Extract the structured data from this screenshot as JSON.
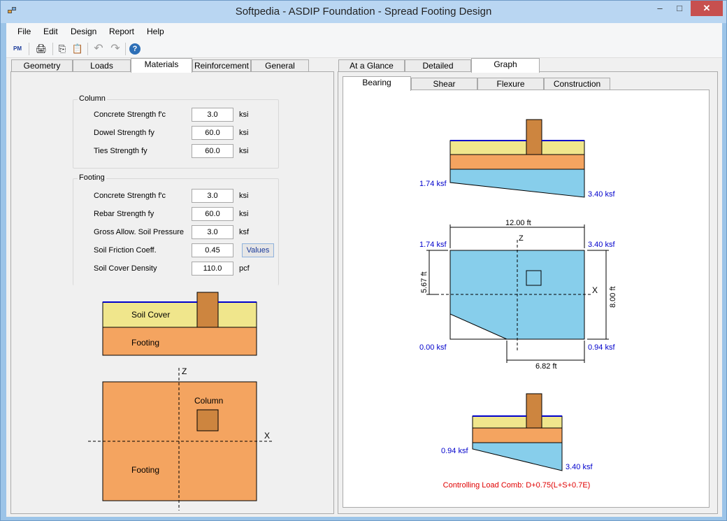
{
  "window": {
    "title": "Softpedia - ASDIP Foundation - Spread Footing Design"
  },
  "menu": [
    "File",
    "Edit",
    "Design",
    "Report",
    "Help"
  ],
  "toolbar": {
    "items": [
      {
        "name": "back-pm-icon",
        "glyph": "PM"
      },
      {
        "name": "print-icon",
        "glyph": "🖨"
      },
      {
        "name": "copy-icon",
        "glyph": "⎘"
      },
      {
        "name": "paste-icon",
        "glyph": "📋"
      },
      {
        "name": "undo-icon",
        "glyph": "↶"
      },
      {
        "name": "redo-icon",
        "glyph": "↷"
      },
      {
        "name": "help-icon",
        "glyph": "?"
      }
    ]
  },
  "left_tabs": [
    {
      "label": "Geometry"
    },
    {
      "label": "Loads"
    },
    {
      "label": "Materials",
      "active": true
    },
    {
      "label": "Reinforcement"
    },
    {
      "label": "General"
    }
  ],
  "right_tabs": [
    {
      "label": "At a Glance"
    },
    {
      "label": "Detailed"
    },
    {
      "label": "Graph",
      "active": true
    }
  ],
  "graph_tabs": [
    {
      "label": "Bearing",
      "active": true
    },
    {
      "label": "Shear"
    },
    {
      "label": "Flexure"
    },
    {
      "label": "Construction"
    }
  ],
  "column_group": {
    "title": "Column",
    "fields": [
      {
        "label": "Concrete Strength  f'c",
        "value": "3.0",
        "unit": "ksi"
      },
      {
        "label": "Dowel Strength  fy",
        "value": "60.0",
        "unit": "ksi"
      },
      {
        "label": "Ties Strength  fy",
        "value": "60.0",
        "unit": "ksi"
      }
    ]
  },
  "footing_group": {
    "title": "Footing",
    "fields": [
      {
        "label": "Concrete Strength  f'c",
        "value": "3.0",
        "unit": "ksi"
      },
      {
        "label": "Rebar Strength  fy",
        "value": "60.0",
        "unit": "ksi"
      },
      {
        "label": "Gross Allow. Soil Pressure",
        "value": "3.0",
        "unit": "ksf"
      },
      {
        "label": "Soil Friction Coeff.",
        "value": "0.45",
        "unit": ""
      },
      {
        "label": "Soil Cover Density",
        "value": "110.0",
        "unit": "pcf"
      }
    ],
    "values_button": "Values"
  },
  "section_diagram": {
    "soil_label": "Soil Cover",
    "footing_label": "Footing"
  },
  "plan_diagram": {
    "z_label": "Z",
    "x_label": "X",
    "column_label": "Column",
    "footing_label": "Footing"
  },
  "bearing": {
    "top_left": "1.74 ksf",
    "top_right": "3.40 ksf",
    "plan_width": "12.00 ft",
    "plan_height": "8.00 ft",
    "plan_offset": "5.67 ft",
    "plan_base": "6.82 ft",
    "corner_tl": "1.74 ksf",
    "corner_tr": "3.40 ksf",
    "corner_bl": "0.00 ksf",
    "corner_br": "0.94 ksf",
    "z_label": "Z",
    "x_label": "X",
    "bottom_left": "0.94 ksf",
    "bottom_right": "3.40 ksf",
    "controlling": "Controlling Load Comb: D+0.75(L+S+0.7E)"
  },
  "colors": {
    "soil": "#f0e68c",
    "footing": "#f4a460",
    "column": "#cd853f",
    "pressure": "#87ceeb",
    "grade_line": "#0000cc",
    "value_text": "#0000cc",
    "warning_text": "#e00000"
  }
}
